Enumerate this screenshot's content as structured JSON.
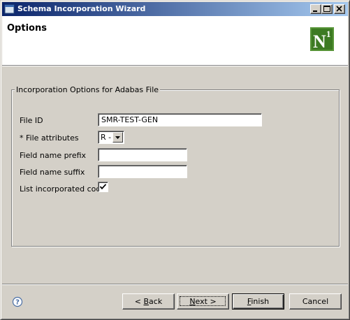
{
  "window": {
    "title": "Schema Incorporation Wizard"
  },
  "header": {
    "title": "Options",
    "logo_text": "N",
    "logo_superscript": "1"
  },
  "group": {
    "title": "Incorporation Options for Adabas File",
    "fields": {
      "file_id": {
        "label": "File ID",
        "value": "SMR-TEST-GEN"
      },
      "file_attributes": {
        "label": "* File attributes",
        "value": "R -"
      },
      "field_name_prefix": {
        "label": "Field name prefix",
        "value": ""
      },
      "field_name_suffix": {
        "label": "Field name suffix",
        "value": ""
      },
      "list_incorporated_code": {
        "label": "List incorporated code",
        "checked": true
      }
    }
  },
  "buttons": {
    "back": {
      "mnemonic": "B",
      "rest": "ack",
      "prefix": "< "
    },
    "next": {
      "mnemonic": "N",
      "rest": "ext",
      "suffix": " >"
    },
    "finish": {
      "mnemonic": "F",
      "rest": "inish"
    },
    "cancel": "Cancel"
  },
  "colors": {
    "titlebar_start": "#0a246a",
    "titlebar_end": "#a6caf0",
    "dialog_bg": "#d4d0c8",
    "logo_green": "#3d7a23"
  },
  "icons": {
    "app": "window-icon",
    "help": "help-icon",
    "checkmark": "check-icon",
    "dropdown": "chevron-down-icon"
  }
}
